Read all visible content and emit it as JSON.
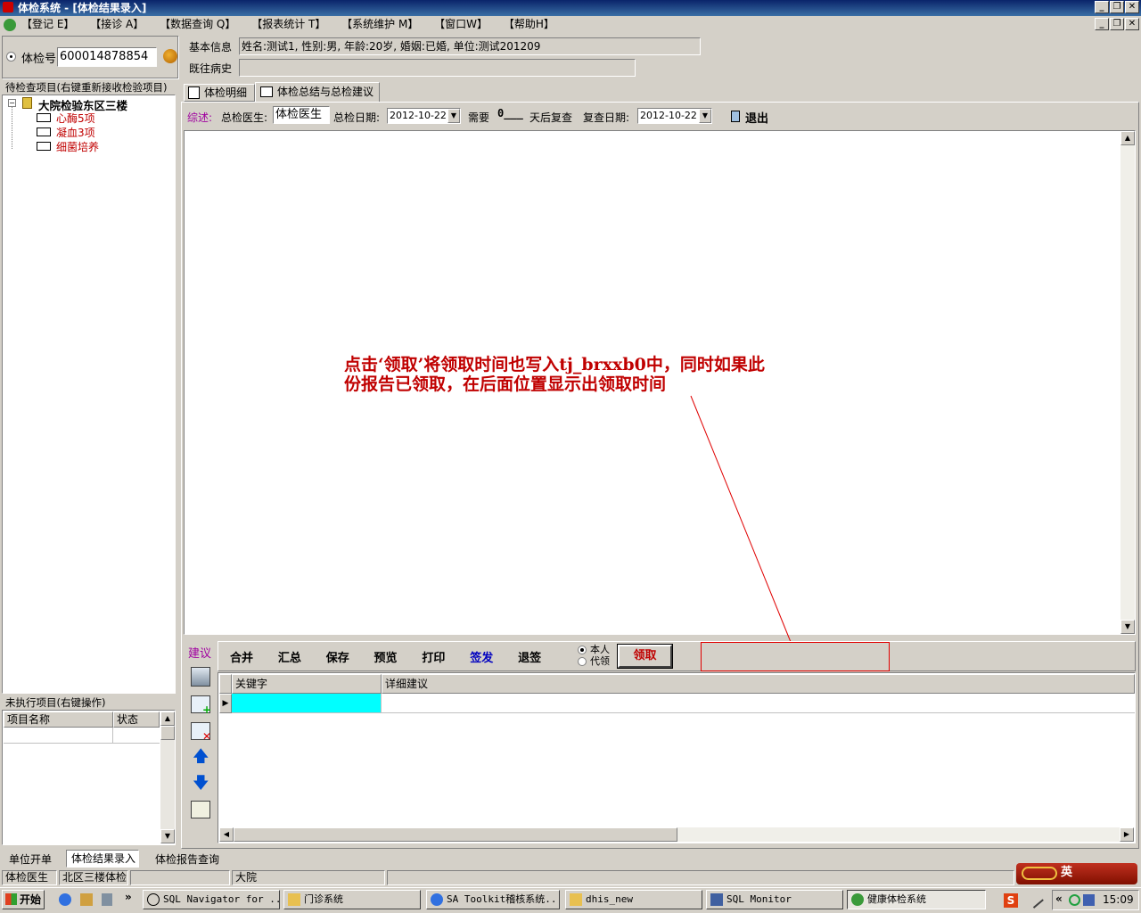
{
  "window": {
    "title": "体检系统 - [体检结果录入]"
  },
  "menu": [
    "【登记 E】",
    "【接诊 A】",
    "【数据查询 Q】",
    "【报表统计 T】",
    "【系统维护 M】",
    "【窗口W】",
    "【帮助H】"
  ],
  "patient": {
    "id_label": "体检号",
    "id_value": "600014878854",
    "basic_label": "基本信息",
    "basic_value": "姓名:测试1, 性别:男, 年龄:20岁, 婚姻:已婚, 单位:测试201209",
    "history_label": "既往病史",
    "history_value": ""
  },
  "pending": {
    "header": "待检查项目(右键重新接收检验项目)",
    "root": "大院检验东区三楼",
    "items": [
      "心酶5项",
      "凝血3项",
      "细菌培养"
    ]
  },
  "unexecuted": {
    "header": "未执行项目(右键操作)",
    "columns": [
      "项目名称",
      "状态"
    ]
  },
  "tabs": [
    "体检明细",
    "体检总结与总检建议"
  ],
  "summary_bar": {
    "summary_label": "综述:",
    "doctor_label": "总检医生:",
    "doctor_value": "体检医生",
    "date_label": "总检日期:",
    "date_value": "2012-10-22",
    "need_label": "需要",
    "days_value": "0___",
    "recheck_suffix": "天后复查",
    "recheck_date_label": "复查日期:",
    "recheck_date_value": "2012-10-22",
    "exit_label": "退出"
  },
  "annotation": {
    "line1": "点击‘领取’将领取时间也写入tj_brxxb0中，同时如果此",
    "line2": "份报告已领取，在后面位置显示出领取时间"
  },
  "suggest": {
    "side_label": "建议",
    "buttons": [
      "合并",
      "汇总",
      "保存",
      "预览",
      "打印",
      "签发",
      "退签"
    ],
    "radio_self": "本人",
    "radio_proxy": "代领",
    "claim_button": "领取",
    "columns": [
      "关键字",
      "详细建议"
    ]
  },
  "bottom_tabs": [
    "单位开单",
    "体检结果录入",
    "体检报告查询"
  ],
  "status": {
    "doctor": "体检医生",
    "dept": "北区三楼体检",
    "blank": "",
    "site": "大院"
  },
  "taskbar": {
    "start": "开始",
    "tasks": [
      "SQL Navigator for ...",
      "门诊系统",
      "SA Toolkit稽核系统...",
      "dhis_new",
      "SQL Monitor",
      "健康体检系统"
    ],
    "ime": "英",
    "clock": "15:09"
  }
}
